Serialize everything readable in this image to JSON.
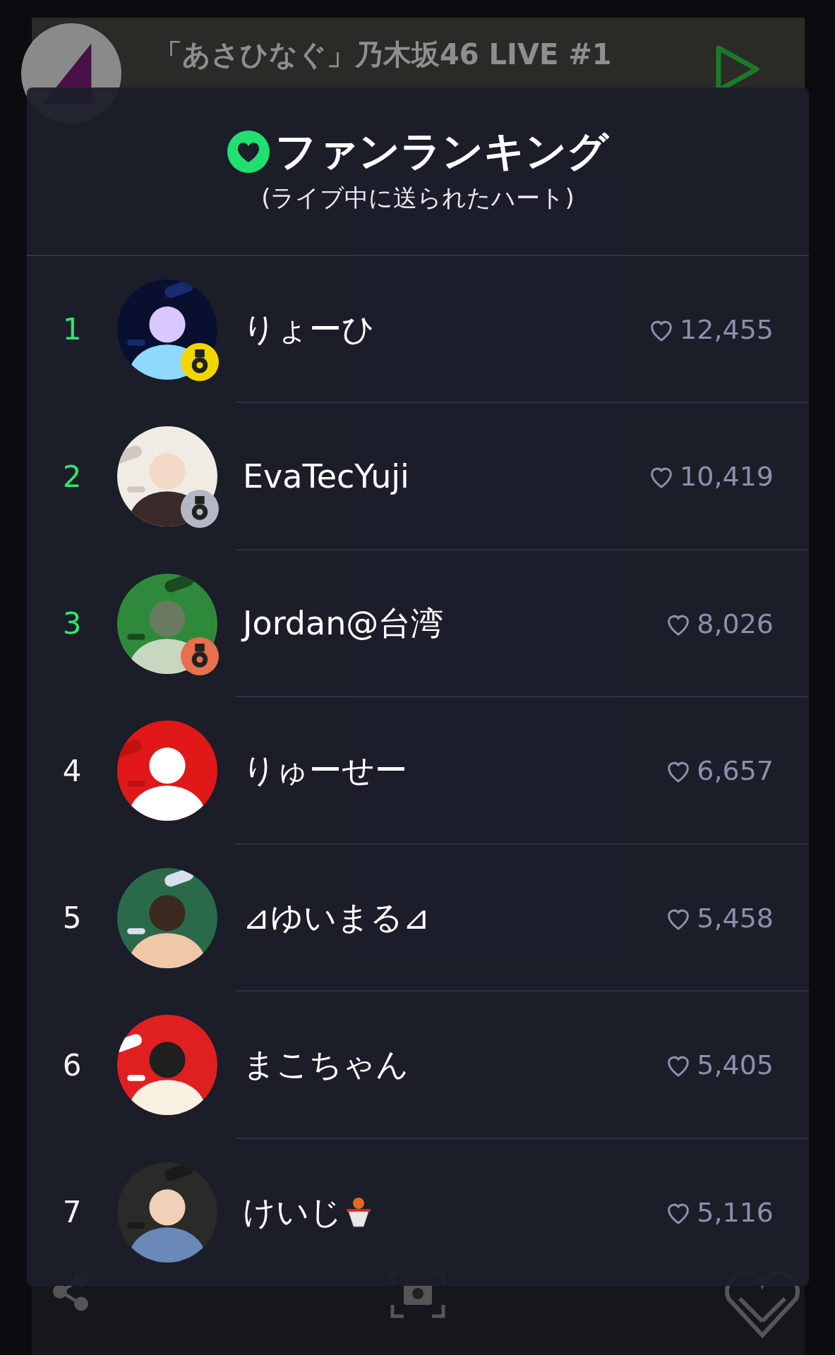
{
  "live": {
    "title": "「あさひなぐ」乃木坂46 LIVE #1"
  },
  "ranking": {
    "title": "ファンランキング",
    "subtitle": "(ライブ中に送られたハート)",
    "rows": [
      {
        "kind": "plain",
        "rank": "1",
        "name": "りょーひ",
        "hearts": "12,455",
        "medal": true,
        "color": "#f2d600"
      },
      {
        "kind": "plain",
        "rank": "2",
        "name": "EvaTecYuji",
        "hearts": "10,419",
        "medal": true,
        "color": "#b4b8c4"
      },
      {
        "kind": "plain",
        "rank": "3",
        "name": "Jordan@台湾",
        "hearts": "8,026",
        "medal": true,
        "color": "#e8704a"
      },
      {
        "kind": "plain",
        "rank": "4",
        "name": "りゅーせー",
        "hearts": "6,657",
        "medal": false
      },
      {
        "kind": "plain",
        "rank": "5",
        "name": "⊿ゆいまる⊿",
        "hearts": "5,458",
        "medal": false
      },
      {
        "kind": "plain",
        "rank": "6",
        "name": "まこちゃん",
        "hearts": "5,405",
        "medal": false
      },
      {
        "kind": "emoji",
        "rank": "7",
        "name": "けいじ",
        "hearts": "5,116",
        "medal": false
      }
    ]
  }
}
